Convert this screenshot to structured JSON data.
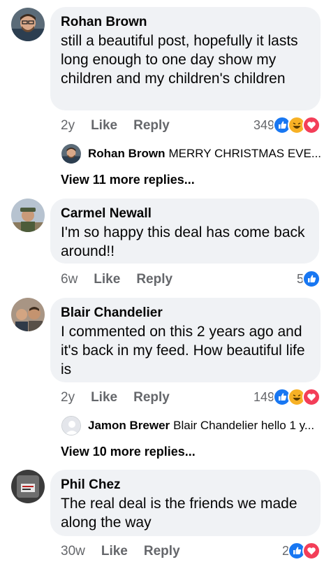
{
  "comments": [
    {
      "author": "Rohan Brown",
      "text": "still a beautiful post, hopefully it lasts long enough to one day show my children and my children's children",
      "time": "2y",
      "like": "Like",
      "reply": "Reply",
      "reactions_count": "349",
      "reactions": [
        "like-icon",
        "haha-icon",
        "love-icon"
      ],
      "reply_preview": {
        "author": "Rohan Brown",
        "text": "MERRY CHRISTMAS EVE..."
      },
      "view_more": "View 11 more replies..."
    },
    {
      "author": "Carmel Newall",
      "text": "I'm so happy this deal has come back around!!",
      "time": "6w",
      "like": "Like",
      "reply": "Reply",
      "reactions_count": "5",
      "reactions": [
        "like-icon"
      ]
    },
    {
      "author": "Blair Chandelier",
      "text": "I commented on this 2 years ago and it's back in my feed. How beautiful life is",
      "time": "2y",
      "like": "Like",
      "reply": "Reply",
      "reactions_count": "149",
      "reactions": [
        "like-icon",
        "haha-icon",
        "love-icon"
      ],
      "reply_preview": {
        "author": "Jamon Brewer",
        "text": "Blair Chandelier hello 1 y..."
      },
      "view_more": "View 10 more replies..."
    },
    {
      "author": "Phil Chez",
      "text": "The real deal is the friends we made along the way",
      "time": "30w",
      "like": "Like",
      "reply": "Reply",
      "reactions_count": "2",
      "reactions": [
        "like-icon",
        "love-icon"
      ]
    }
  ],
  "colors": {
    "like_blue": "#1877f2",
    "love_red": "#f33e58",
    "haha_yellow": "#f7b125",
    "meta_gray": "#65676b",
    "bubble": "#f0f2f5"
  }
}
